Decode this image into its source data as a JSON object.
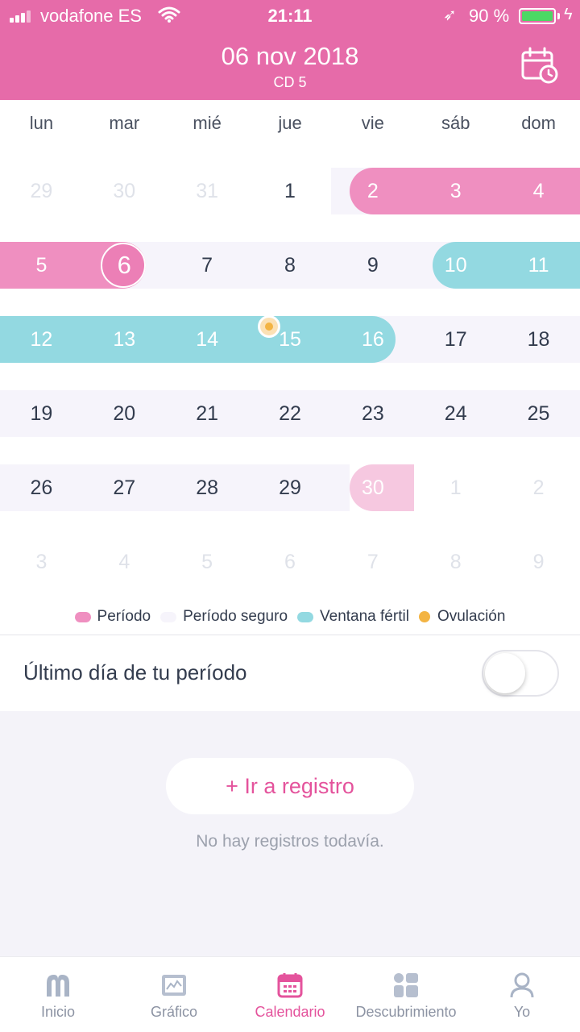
{
  "status_bar": {
    "carrier": "vodafone ES",
    "time": "21:11",
    "battery_pct": "90 %",
    "colors": {
      "battery": "#4cd964"
    }
  },
  "header": {
    "date": "06 nov 2018",
    "cycle_day": "CD 5",
    "calendar_icon": "calendar-clock-icon",
    "colors": {
      "background": "#e66ba9"
    }
  },
  "weekdays": [
    "lun",
    "mar",
    "mié",
    "jue",
    "vie",
    "sáb",
    "dom"
  ],
  "calendar": {
    "today": "6",
    "ovulation_day": "15",
    "rows": [
      [
        "29",
        "30",
        "31",
        "1",
        "2",
        "3",
        "4"
      ],
      [
        "5",
        "6",
        "7",
        "8",
        "9",
        "10",
        "11"
      ],
      [
        "12",
        "13",
        "14",
        "15",
        "16",
        "17",
        "18"
      ],
      [
        "19",
        "20",
        "21",
        "22",
        "23",
        "24",
        "25"
      ],
      [
        "26",
        "27",
        "28",
        "29",
        "30",
        "1",
        "2"
      ],
      [
        "3",
        "4",
        "5",
        "6",
        "7",
        "8",
        "9"
      ]
    ],
    "colors": {
      "period": "#ef8fc0",
      "fertile": "#93d9e1",
      "safe": "#f6f4fb",
      "predicted": "#f6c8e0",
      "ovulation": "#f3b443"
    }
  },
  "legend": {
    "period": "Período",
    "safe": "Período seguro",
    "fertile": "Ventana fértil",
    "ovulation": "Ovulación"
  },
  "last_day": {
    "label": "Último día de tu período",
    "toggle_on": false
  },
  "records": {
    "button": "+ Ir a registro",
    "empty": "No hay registros todavía."
  },
  "tabs": [
    {
      "label": "Inicio",
      "icon": "home-icon",
      "active": false
    },
    {
      "label": "Gráfico",
      "icon": "chart-icon",
      "active": false
    },
    {
      "label": "Calendario",
      "icon": "calendar-icon",
      "active": true
    },
    {
      "label": "Descubrimiento",
      "icon": "discover-icon",
      "active": false
    },
    {
      "label": "Yo",
      "icon": "user-icon",
      "active": false
    }
  ],
  "accent": "#e4539c"
}
